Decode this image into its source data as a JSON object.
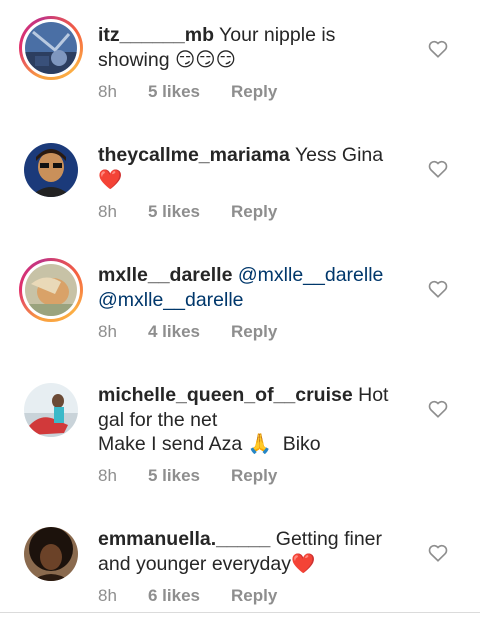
{
  "comments": [
    {
      "username": "itz______mb",
      "text": " Your nipple is showing ",
      "emoji": "😏😏😏",
      "time": "8h",
      "likes": "5 likes",
      "reply": "Reply"
    },
    {
      "username": "theycallme_mariama",
      "text": " Yess Gina",
      "emoji": "❤️",
      "time": "8h",
      "likes": "5 likes",
      "reply": "Reply"
    },
    {
      "username": "mxlle__darelle",
      "mention1": "@mxlle__darelle",
      "mention2": "@mxlle__darelle",
      "time": "8h",
      "likes": "4 likes",
      "reply": "Reply"
    },
    {
      "username": "michelle_queen_of__cruise",
      "text": " Hot gal for the net",
      "text2": "Make I send Aza ",
      "emoji": "🙏",
      "text3": "  Biko",
      "time": "8h",
      "likes": "5 likes",
      "reply": "Reply"
    },
    {
      "username": "emmanuella._____",
      "text": " Getting finer and younger everyday",
      "emoji": "❤️",
      "time": "8h",
      "likes": "6 likes",
      "reply": "Reply"
    }
  ],
  "icons": {
    "like": "heart-outline-icon"
  },
  "colors": {
    "mention": "#00376b",
    "meta": "#8e8e8e",
    "heart_red": "#ed4956"
  }
}
